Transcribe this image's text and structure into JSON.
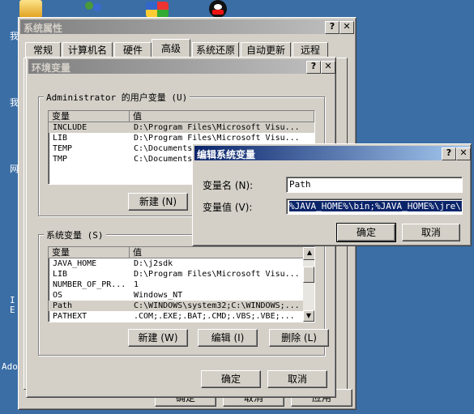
{
  "desktop": {
    "left_labels": [
      "我",
      "我",
      "网",
      "I",
      "E",
      "Ado"
    ]
  },
  "sys_props": {
    "title": "系统属性",
    "tabs": [
      "常规",
      "计算机名",
      "硬件",
      "高级",
      "系统还原",
      "自动更新",
      "远程"
    ],
    "bottom_buttons": [
      "确定",
      "取消",
      "应用"
    ]
  },
  "env": {
    "title": "环境变量",
    "user_group": "Administrator 的用户变量 (U)",
    "col_var": "变量",
    "col_val": "值",
    "user_rows": [
      {
        "name": "INCLUDE",
        "value": "D:\\Program Files\\Microsoft Visu..."
      },
      {
        "name": "LIB",
        "value": "D:\\Program Files\\Microsoft Visu..."
      },
      {
        "name": "TEMP",
        "value": "C:\\Documents"
      },
      {
        "name": "TMP",
        "value": "C:\\Documents"
      }
    ],
    "user_buttons": {
      "new": "新建 (N)"
    },
    "sys_group": "系统变量 (S)",
    "sys_rows": [
      {
        "name": "JAVA_HOME",
        "value": "D:\\j2sdk"
      },
      {
        "name": "LIB",
        "value": "D:\\Program Files\\Microsoft Visu..."
      },
      {
        "name": "NUMBER_OF_PR...",
        "value": "1"
      },
      {
        "name": "OS",
        "value": "Windows_NT"
      },
      {
        "name": "Path",
        "value": "C:\\WINDOWS\\system32;C:\\WINDOWS;..."
      },
      {
        "name": "PATHEXT",
        "value": ".COM;.EXE;.BAT;.CMD;.VBS;.VBE;..."
      }
    ],
    "sys_buttons": {
      "new": "新建 (W)",
      "edit": "编辑 (I)",
      "delete": "删除 (L)"
    },
    "ok": "确定",
    "cancel": "取消"
  },
  "edit": {
    "title": "编辑系统变量",
    "name_label": "变量名 (N):",
    "name_value": "Path",
    "value_label": "变量值 (V):",
    "value_value": "%JAVA_HOME%\\bin;%JAVA_HOME%\\jre\\bin",
    "ok": "确定",
    "cancel": "取消"
  },
  "window_buttons": {
    "help": "?",
    "close": "✕"
  }
}
